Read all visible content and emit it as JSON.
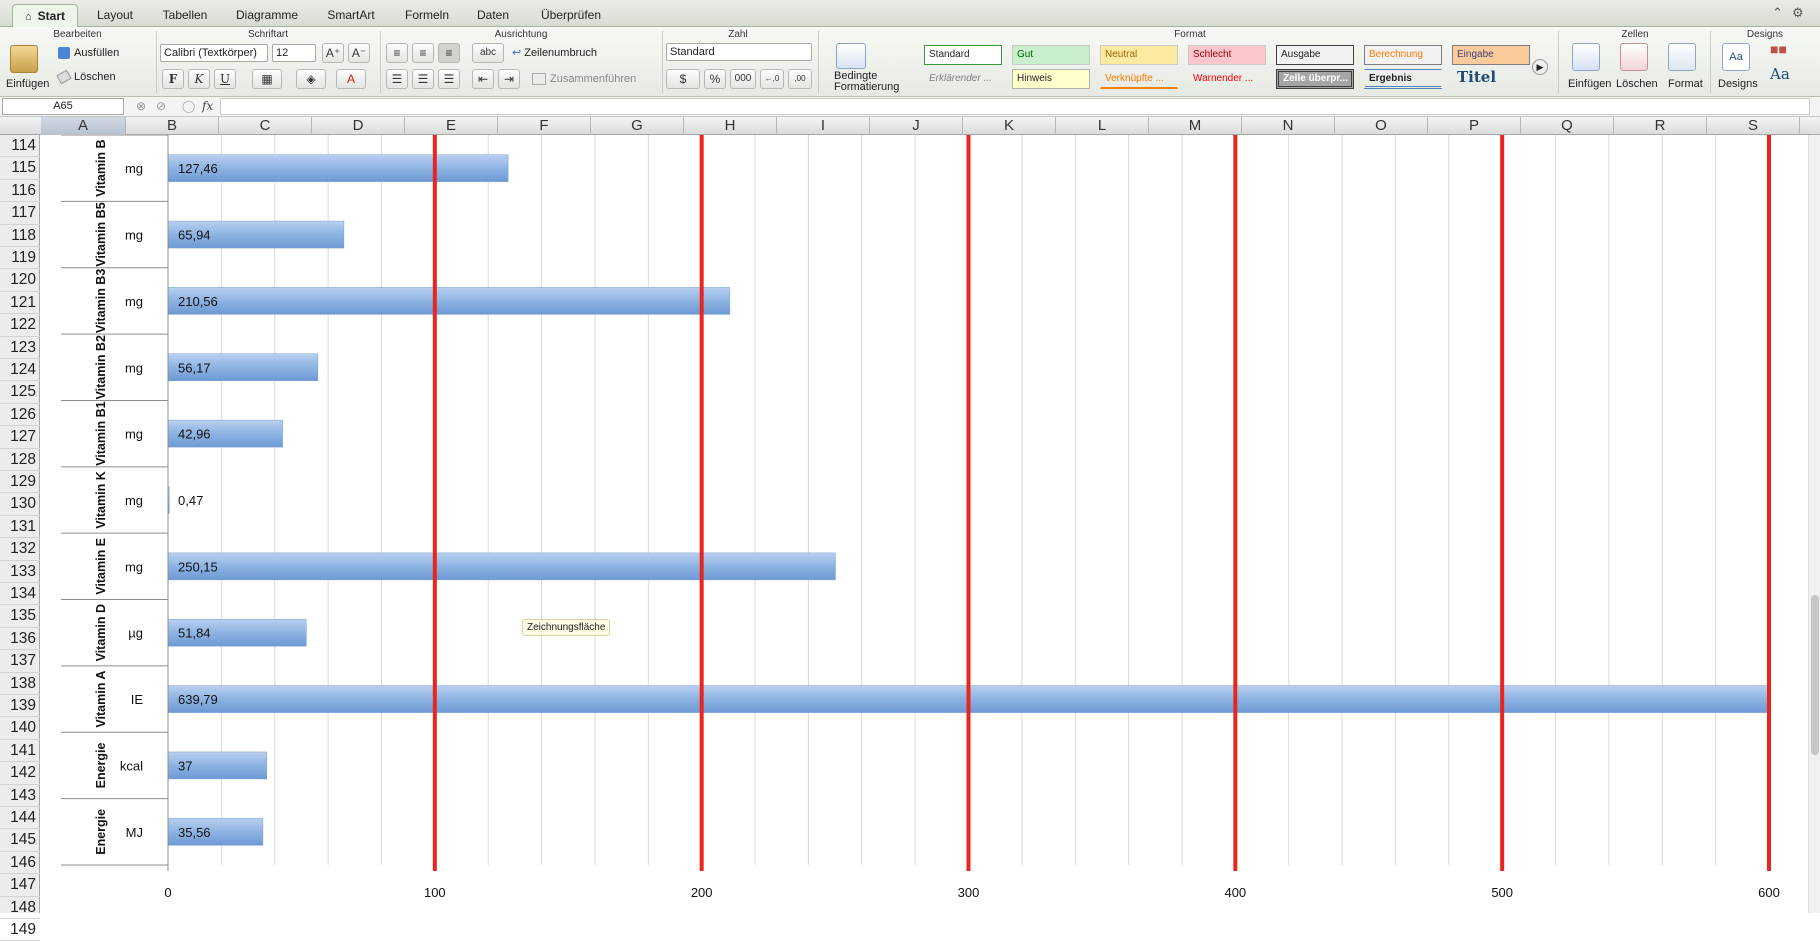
{
  "tabs": [
    {
      "label": "Start",
      "active": true
    },
    {
      "label": "Layout"
    },
    {
      "label": "Tabellen"
    },
    {
      "label": "Diagramme"
    },
    {
      "label": "SmartArt"
    },
    {
      "label": "Formeln"
    },
    {
      "label": "Daten"
    },
    {
      "label": "Überprüfen"
    }
  ],
  "ribbon": {
    "groups": {
      "bearbeiten": "Bearbeiten",
      "schriftart": "Schriftart",
      "ausrichtung": "Ausrichtung",
      "zahl": "Zahl",
      "format": "Format",
      "zellen": "Zellen",
      "designs": "Designs"
    },
    "einfuegen": "Einfügen",
    "ausfuellen": "Ausfüllen",
    "loeschen": "Löschen",
    "font_name": "Calibri (Textkörper)",
    "font_size": "12",
    "bold": "F",
    "italic": "K",
    "underline": "U",
    "wrap_prefix": "abc",
    "zeilenumbruch": "Zeilenumbruch",
    "zusammenfuehren": "Zusammenführen",
    "number_format": "Standard",
    "percent": "%",
    "thousands": "000",
    "dec_inc": "←,0",
    "dec_dec": ",00",
    "bedingte_1": "Bedingte",
    "bedingte_2": "Formatierung",
    "styles_row1": [
      "Standard",
      "Gut",
      "Neutral",
      "Schlecht",
      "Ausgabe",
      "Berechnung",
      "Eingabe"
    ],
    "styles_row2": [
      "Erklärender ...",
      "Hinweis",
      "Verknüpfte ...",
      "Warnender ...",
      "Zelle überpr...",
      "Ergebnis",
      "Titel"
    ],
    "zellen_einfuegen": "Einfügen",
    "zellen_loeschen": "Löschen",
    "zellen_format": "Format",
    "designs_label": "Designs",
    "designs_aa": "Aa"
  },
  "formula_bar": {
    "name_box": "A65",
    "fx": "fx",
    "value": ""
  },
  "columns": [
    "A",
    "B",
    "C",
    "D",
    "E",
    "F",
    "G",
    "H",
    "I",
    "J",
    "K",
    "L",
    "M",
    "N",
    "O",
    "P",
    "Q",
    "R",
    "S"
  ],
  "rows": [
    "114",
    "115",
    "116",
    "117",
    "118",
    "119",
    "120",
    "121",
    "122",
    "123",
    "124",
    "125",
    "126",
    "127",
    "128",
    "129",
    "130",
    "131",
    "132",
    "133",
    "134",
    "135",
    "136",
    "137",
    "138",
    "139",
    "140",
    "141",
    "142",
    "143",
    "144",
    "145",
    "146",
    "147",
    "148",
    "149"
  ],
  "tooltip": "Zeichnungsfläche",
  "chart_data": {
    "type": "bar",
    "orientation": "horizontal",
    "categories": [
      {
        "name": "Vitamin B",
        "unit": "mg"
      },
      {
        "name": "Vitamin B5",
        "unit": "mg"
      },
      {
        "name": "Vitamin B3",
        "unit": "mg"
      },
      {
        "name": "Vitamin B2",
        "unit": "mg"
      },
      {
        "name": "Vitamin B1",
        "unit": "mg"
      },
      {
        "name": "Vitamin K",
        "unit": "mg"
      },
      {
        "name": "Vitamin E",
        "unit": "mg"
      },
      {
        "name": "Vitamin D",
        "unit": "µg"
      },
      {
        "name": "Vitamin A",
        "unit": "IE"
      },
      {
        "name": "Energie",
        "unit": "kcal"
      },
      {
        "name": "Energie",
        "unit": "MJ"
      }
    ],
    "values": [
      127.46,
      65.94,
      210.56,
      56.17,
      42.96,
      0.47,
      250.15,
      51.84,
      639.79,
      37,
      35.56
    ],
    "value_labels": [
      "127,46",
      "65,94",
      "210,56",
      "56,17",
      "42,96",
      "0,47",
      "250,15",
      "51,84",
      "639,79",
      "37",
      "35,56"
    ],
    "xlim": [
      0,
      600
    ],
    "xticks": [
      "0",
      "100",
      "200",
      "300",
      "400",
      "500",
      "600"
    ],
    "gridlines": "minor every 20, red major every 100",
    "bar_color": "#8db3e2",
    "major_line_color": "#e8261e"
  }
}
